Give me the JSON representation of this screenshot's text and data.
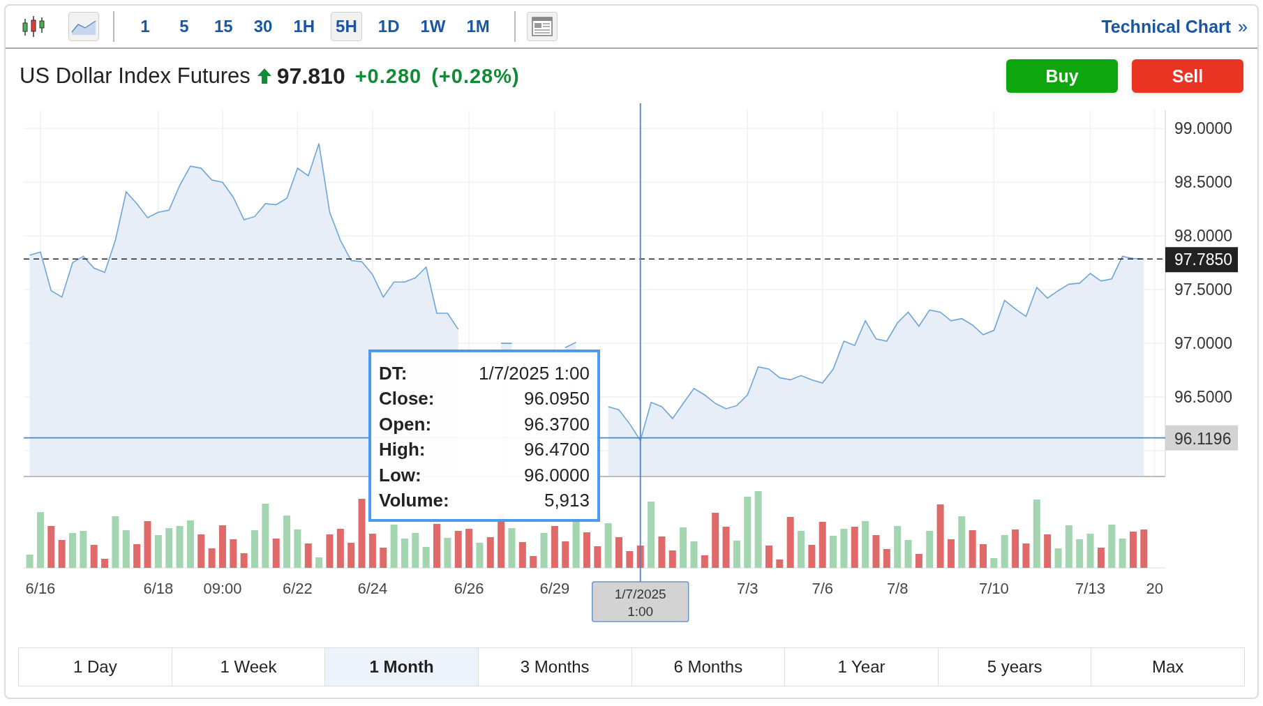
{
  "toolbar": {
    "chart_types": [
      {
        "kind": "candlestick",
        "selected": false
      },
      {
        "kind": "line",
        "selected": true
      }
    ],
    "intervals": [
      {
        "label": "1",
        "selected": false
      },
      {
        "label": "5",
        "selected": false
      },
      {
        "label": "15",
        "selected": false
      },
      {
        "label": "30",
        "selected": false
      },
      {
        "label": "1H",
        "selected": false
      },
      {
        "label": "5H",
        "selected": true
      },
      {
        "label": "1D",
        "selected": false
      },
      {
        "label": "1W",
        "selected": false
      },
      {
        "label": "1M",
        "selected": false
      }
    ],
    "link": {
      "label": "Technical Chart",
      "icon": "»"
    }
  },
  "instrument": {
    "name": "US Dollar Index Futures",
    "rising": true,
    "price": "97.810",
    "change": "+0.280",
    "change_pct": "(+0.28%)"
  },
  "actions": [
    {
      "kind": "buy",
      "label": "Buy"
    },
    {
      "kind": "sell",
      "label": "Sell"
    }
  ],
  "chart_data": {
    "type": "area",
    "grid": true,
    "categories": [
      null,
      "6/16",
      null,
      null,
      null,
      null,
      null,
      null,
      null,
      null,
      null,
      null,
      "6/18",
      null,
      null,
      null,
      null,
      null,
      "09:00",
      null,
      null,
      null,
      null,
      null,
      null,
      "6/22",
      null,
      null,
      null,
      null,
      null,
      null,
      "6/24",
      null,
      null,
      null,
      null,
      null,
      null,
      null,
      null,
      "6/26",
      null,
      null,
      null,
      null,
      null,
      null,
      null,
      "6/29",
      null,
      null,
      null,
      null,
      null,
      null,
      null,
      null,
      null,
      null,
      null,
      null,
      null,
      null,
      null,
      null,
      null,
      "7/3",
      null,
      null,
      null,
      null,
      null,
      null,
      "7/6",
      null,
      null,
      null,
      null,
      null,
      null,
      "7/8",
      null,
      null,
      null,
      null,
      null,
      null,
      null,
      null,
      "7/10",
      null,
      null,
      null,
      null,
      null,
      null,
      null,
      null,
      "7/13",
      null,
      null,
      null,
      null,
      null,
      "20"
    ],
    "series": [
      {
        "color": "#6ea5d6",
        "values": [
          97.82,
          97.85,
          97.49,
          97.43,
          97.75,
          97.81,
          97.7,
          97.66,
          97.96,
          98.41,
          98.3,
          98.17,
          98.22,
          98.24,
          98.47,
          98.65,
          98.63,
          98.52,
          98.5,
          98.36,
          98.15,
          98.18,
          98.3,
          98.29,
          98.35,
          98.63,
          98.56,
          98.86,
          98.22,
          97.96,
          97.77,
          97.76,
          97.64,
          97.43,
          97.57,
          97.57,
          97.61,
          97.71,
          97.28,
          97.28,
          97.13,
          null,
          null,
          null,
          97.0,
          97.0,
          null,
          null,
          null,
          null,
          96.96,
          97.01,
          null,
          null,
          96.41,
          96.38,
          96.25,
          96.095,
          96.45,
          96.41,
          96.3,
          96.44,
          96.58,
          96.52,
          96.44,
          96.39,
          96.42,
          96.52,
          96.78,
          96.76,
          96.68,
          96.66,
          96.7,
          96.66,
          96.63,
          96.76,
          97.02,
          96.98,
          97.21,
          97.04,
          97.02,
          97.19,
          97.29,
          97.16,
          97.31,
          97.29,
          97.21,
          97.23,
          97.17,
          97.08,
          97.12,
          97.4,
          97.32,
          97.25,
          97.52,
          97.42,
          97.49,
          97.55,
          97.56,
          97.65,
          97.58,
          97.6,
          97.81,
          97.79,
          97.785,
          null
        ]
      }
    ],
    "ylim": [
      95.76,
      99.17
    ],
    "yticks": [
      {
        "value": 96.5,
        "label": "96.5000"
      },
      {
        "value": 97,
        "label": "97.0000"
      },
      {
        "value": 97.5,
        "label": "97.5000"
      },
      {
        "value": 98,
        "label": "98.0000"
      },
      {
        "value": 98.5,
        "label": "98.5000"
      },
      {
        "value": 99,
        "label": "99.0000"
      }
    ],
    "ref_lines": [
      {
        "axis": "y",
        "value": 97.785,
        "label": "97.7850",
        "color": "#222222"
      },
      {
        "axis": "y",
        "value": 96.1196,
        "label": "96.1196",
        "color": "#4a86c5"
      }
    ]
  },
  "crosshair_tag": {
    "date": "1/7/2025",
    "time": "1:00"
  },
  "tooltip": [
    {
      "label": "DT:",
      "value": "1/7/2025 1:00"
    },
    {
      "label": "Close:",
      "value": "96.0950"
    },
    {
      "label": "Open:",
      "value": "96.3700"
    },
    {
      "label": "High:",
      "value": "96.4700"
    },
    {
      "label": "Low:",
      "value": "96.0000"
    },
    {
      "label": "Volume:",
      "value": "5,913"
    }
  ],
  "ranges": [
    {
      "label": "1 Day",
      "selected": false
    },
    {
      "label": "1 Week",
      "selected": false
    },
    {
      "label": "1 Month",
      "selected": true
    },
    {
      "label": "3 Months",
      "selected": false
    },
    {
      "label": "6 Months",
      "selected": false
    },
    {
      "label": "1 Year",
      "selected": false
    },
    {
      "label": "5 years",
      "selected": false
    },
    {
      "label": "Max",
      "selected": false
    }
  ]
}
